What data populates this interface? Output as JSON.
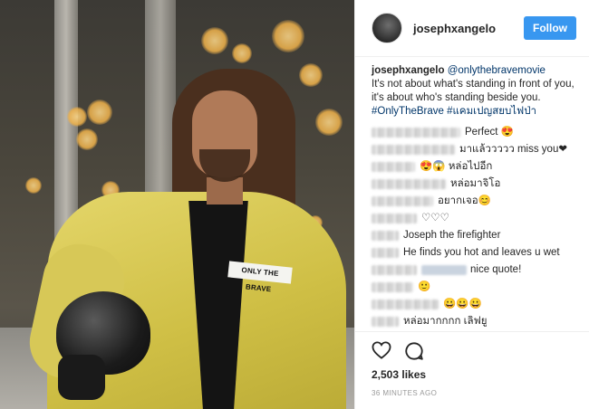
{
  "header": {
    "username": "josephxangelo",
    "follow_label": "Follow"
  },
  "photo": {
    "patch_text": "ONLY THE BRAVE"
  },
  "caption": {
    "username": "josephxangelo",
    "mention": "@onlythebravemovie",
    "text": "It's not about what's standing in front of you, it's about who's standing beside you.",
    "hashtags": "#OnlyTheBrave #แคมเปญสยบไฟป่า"
  },
  "comments": [
    {
      "text": "Perfect 😍"
    },
    {
      "text": "มาแล้ววววว miss you❤"
    },
    {
      "text": "😍😱 หล่อไปอีก"
    },
    {
      "text": "หล่อมาจิโอ"
    },
    {
      "text": "อยากเจอ😊"
    },
    {
      "text": "♡♡♡"
    },
    {
      "text": "Joseph the firefighter"
    },
    {
      "text": "He finds you hot and leaves u wet"
    },
    {
      "text": "nice quote!"
    },
    {
      "text": "🙂"
    },
    {
      "text": "😀😀😀"
    },
    {
      "text": "หล่อมากกกก เลิฟยู"
    }
  ],
  "stats": {
    "likes": "2,503 likes",
    "time": "36 MINUTES AGO"
  },
  "icons": {
    "like": "heart-icon",
    "comment": "comment-icon"
  },
  "colors": {
    "follow_button": "#3897f0",
    "link": "#003569"
  }
}
